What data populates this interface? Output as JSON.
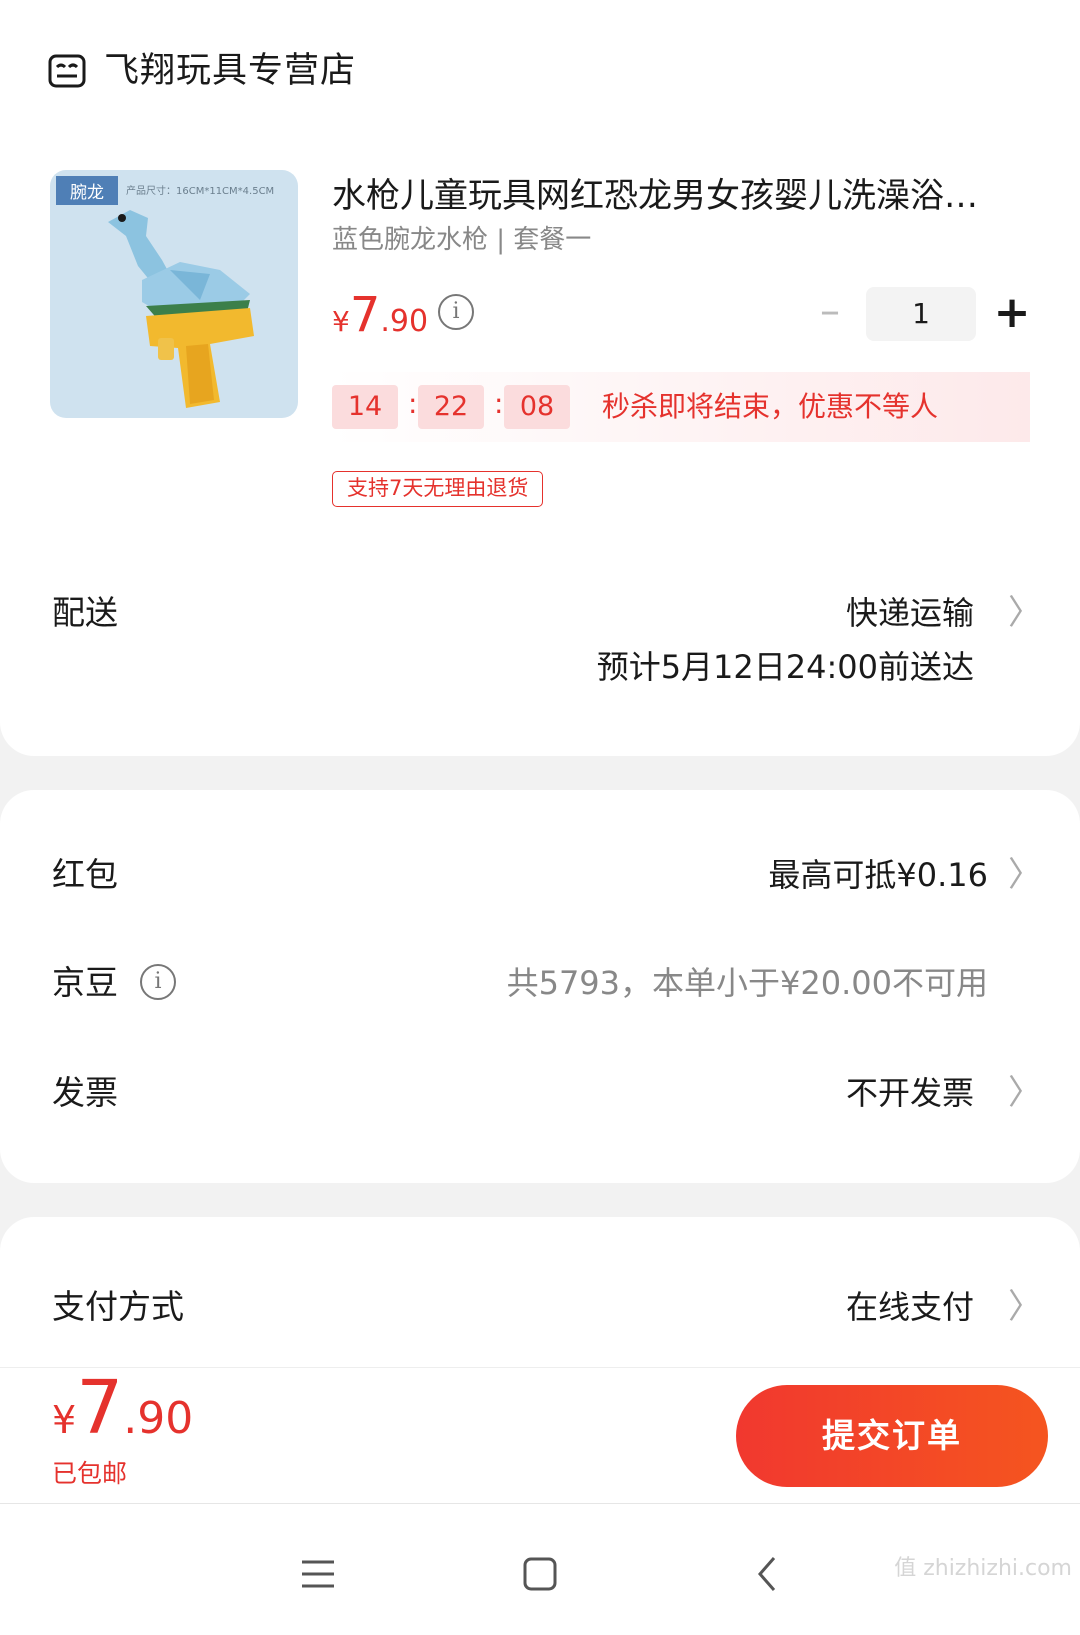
{
  "store": {
    "name": "飞翔玩具专营店",
    "icon": "store-icon"
  },
  "product": {
    "image_tag": "腕龙",
    "image_size_text": "产品尺寸：16CM*11CM*4.5CM",
    "title": "水枪儿童玩具网红恐龙男女孩婴儿洗澡浴…",
    "variant": "蓝色腕龙水枪 | 套餐一",
    "price": {
      "currency": "¥",
      "integer": "7",
      "decimal": ".90"
    },
    "price_info_icon": "info-icon",
    "quantity": "1",
    "minus_icon": "minus-icon",
    "plus_icon": "plus-icon",
    "countdown": {
      "h": "14",
      "m": "22",
      "s": "08",
      "sep": ":"
    },
    "flash_text": "秒杀即将结束，优惠不等人",
    "return_badge": "支持7天无理由退货"
  },
  "delivery": {
    "label": "配送",
    "method": "快递运输",
    "estimate": "预计5月12日24:00前送达"
  },
  "redpacket": {
    "label": "红包",
    "value": "最高可抵¥0.16"
  },
  "jingdou": {
    "label": "京豆",
    "value": "共5793，本单小于¥20.00不可用"
  },
  "invoice": {
    "label": "发票",
    "value": "不开发票"
  },
  "payment": {
    "label": "支付方式",
    "value": "在线支付"
  },
  "footer": {
    "total": {
      "currency": "¥",
      "integer": "7",
      "decimal": ".90"
    },
    "shipping": "已包邮",
    "submit_label": "提交订单"
  },
  "chevron": "〉",
  "watermark": "值 zhizhizhi.com",
  "colors": {
    "accent": "#e5322d",
    "button": "#f1382f"
  }
}
